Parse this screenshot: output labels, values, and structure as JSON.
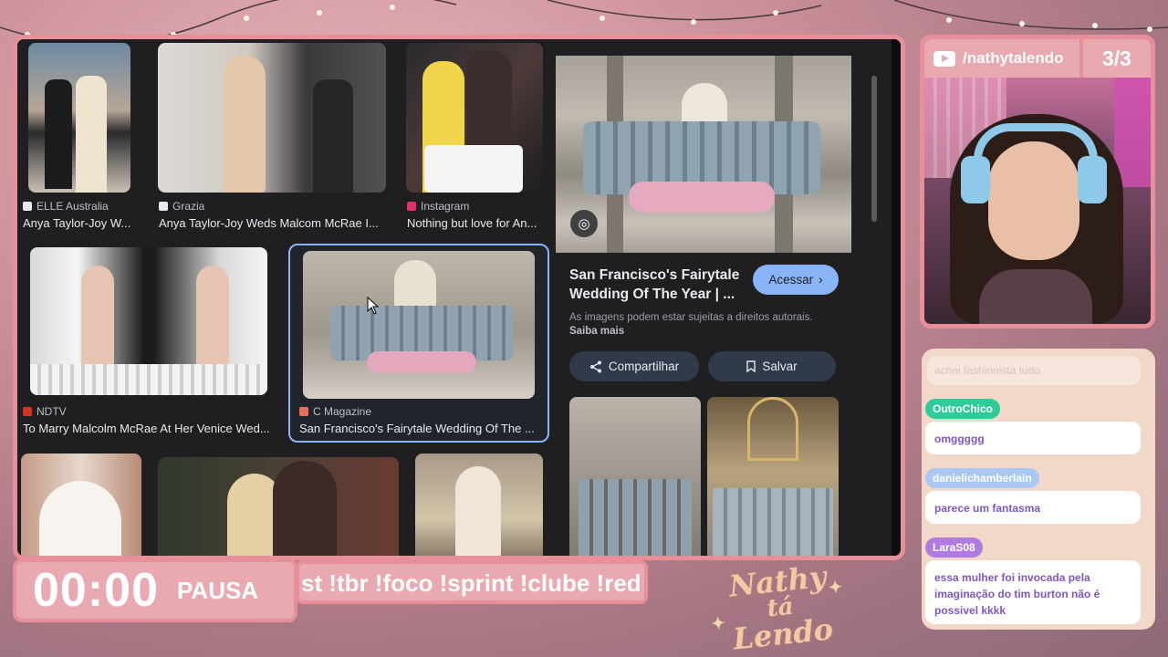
{
  "image_results": [
    {
      "source": "ELLE Australia",
      "title": "Anya Taylor-Joy W...",
      "favicon_color": "#e8eaed"
    },
    {
      "source": "Grazia",
      "title": "Anya Taylor-Joy Weds Malcom McRae I...",
      "favicon_color": "#e8eaed"
    },
    {
      "source": "Instagram",
      "title": "Nothing but love for An...",
      "favicon_color": "#e1306c"
    },
    {
      "source": "NDTV",
      "title": "To Marry Malcolm McRae At Her Venice Wed...",
      "favicon_color": "#d93025"
    },
    {
      "source": "C Magazine",
      "title": "San Francisco's Fairytale Wedding Of The ...",
      "favicon_color": "#e8705d"
    }
  ],
  "detail_panel": {
    "title": "San Francisco's Fairytale Wedding Of The Year | ...",
    "visit_label": "Acessar",
    "copyright_text": "As imagens podem estar sujeitas a direitos autorais.",
    "learn_more_label": "Saiba mais",
    "share_label": "Compartilhar",
    "save_label": "Salvar"
  },
  "overlay": {
    "timer": "00:00",
    "timer_state": "PAUSA",
    "commands_ticker": "st !tbr !foco !sprint !clube !red",
    "brand_line1": "Nathy",
    "brand_line2": "tá",
    "brand_line3": "Lendo"
  },
  "webcam": {
    "channel_handle": "/nathytalendo",
    "counter": "3/3"
  },
  "chat": {
    "faded_message": "achei fashionista tudo",
    "messages": [
      {
        "user": "OutroChico",
        "text": "omggggg",
        "user_color": "#2ecc9a"
      },
      {
        "user": "danielichamberlain",
        "text": "parece um fantasma",
        "user_color": "#a9c9f2"
      },
      {
        "user": "LaraS08",
        "text": "essa mulher foi invocada pela imaginação do tim burton não é possivel kkkk",
        "user_color": "#b07be0"
      }
    ]
  },
  "colors": {
    "frame_border": "#e8909a",
    "overlay_fill": "#e9a9b1",
    "google_blue": "#8ab4f8",
    "dark_bg": "#1f1f21"
  }
}
